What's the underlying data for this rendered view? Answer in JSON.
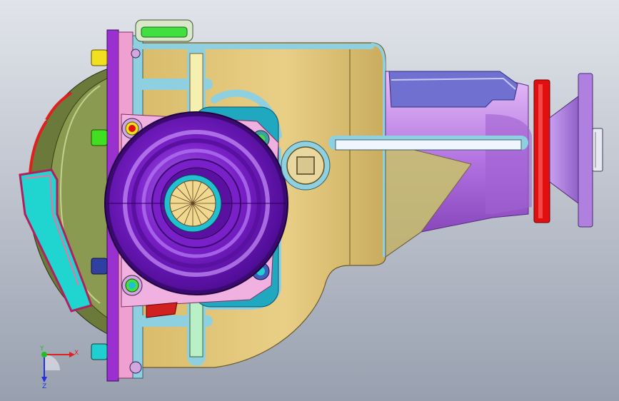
{
  "viewport": {
    "background_top": "#dfe2e9",
    "background_bottom": "#9aa1b0"
  },
  "triad": {
    "x_label": "X",
    "y_label": "Y",
    "z_label": "Z",
    "x_color": "#e02020",
    "y_color": "#20c020",
    "z_color": "#2030e0"
  },
  "model": {
    "name_icon": "differential-gearbox-3d-model",
    "colors": {
      "housing": "#e3c77a",
      "pipe": "#8fd3e0",
      "flange": "#9b30d0",
      "cover": "#7a1fbf",
      "pinion_housing": "#c07ae0",
      "seal_red": "#e01010",
      "gasket_pink": "#f0a0d0",
      "cyan_bracket": "#20d0d0",
      "green_cap": "#40e040",
      "bolt_yellow": "#f0e020"
    }
  }
}
